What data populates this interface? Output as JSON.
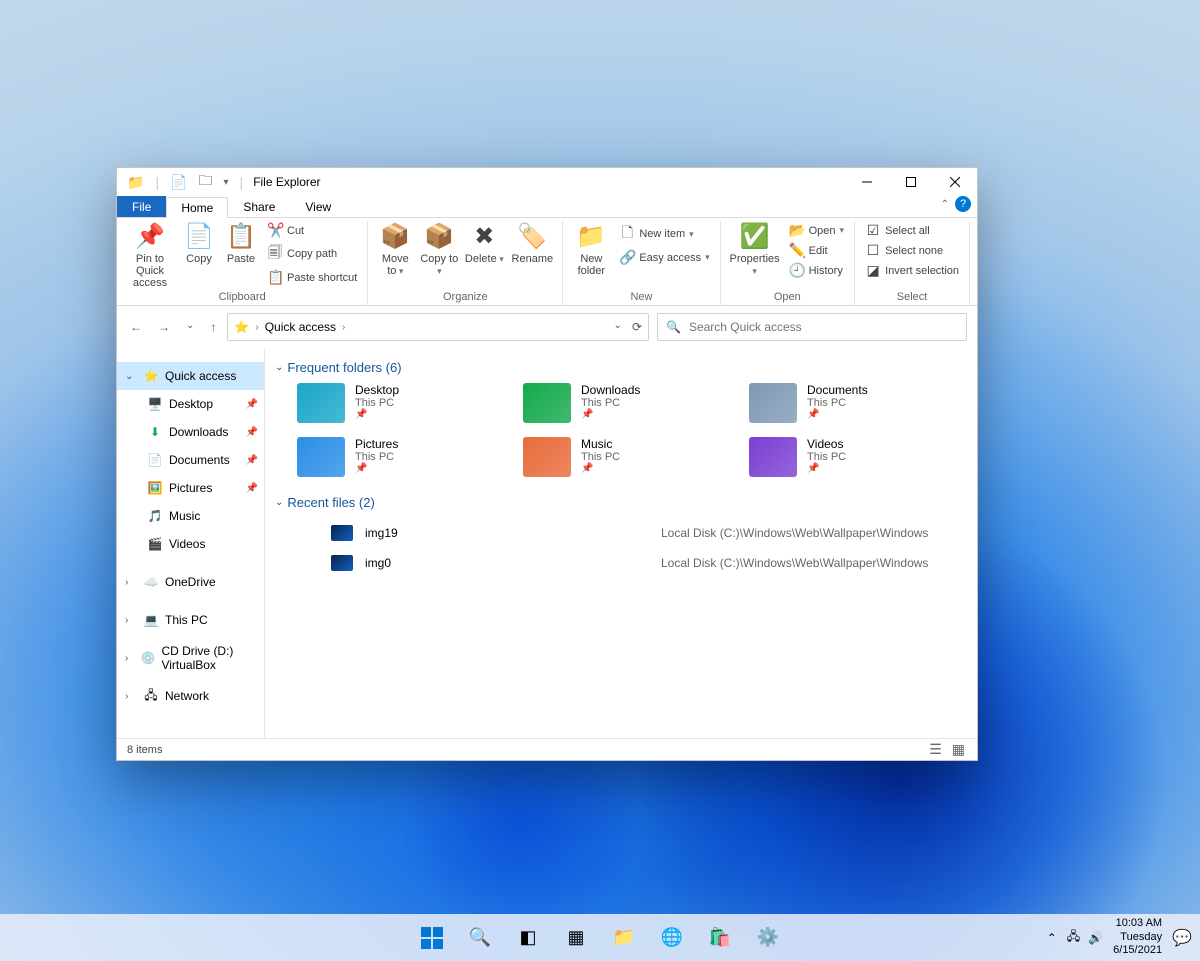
{
  "window": {
    "title": "File Explorer",
    "tabs": {
      "file": "File",
      "home": "Home",
      "share": "Share",
      "view": "View"
    }
  },
  "ribbon": {
    "clipboard": {
      "label": "Clipboard",
      "pin": "Pin to Quick access",
      "copy": "Copy",
      "paste": "Paste",
      "cut": "Cut",
      "copy_path": "Copy path",
      "paste_shortcut": "Paste shortcut"
    },
    "organize": {
      "label": "Organize",
      "move": "Move to",
      "copy": "Copy to",
      "delete": "Delete",
      "rename": "Rename"
    },
    "new_group": {
      "label": "New",
      "new_folder": "New folder",
      "new_item": "New item",
      "easy_access": "Easy access"
    },
    "open_group": {
      "label": "Open",
      "properties": "Properties",
      "open": "Open",
      "edit": "Edit",
      "history": "History"
    },
    "select_group": {
      "label": "Select",
      "select_all": "Select all",
      "select_none": "Select none",
      "invert": "Invert selection"
    }
  },
  "address": {
    "location": "Quick access",
    "search_placeholder": "Search Quick access"
  },
  "sidebar": {
    "quick_access": "Quick access",
    "desktop": "Desktop",
    "downloads": "Downloads",
    "documents": "Documents",
    "pictures": "Pictures",
    "music": "Music",
    "videos": "Videos",
    "onedrive": "OneDrive",
    "this_pc": "This PC",
    "cd_drive": "CD Drive (D:) VirtualBox",
    "network": "Network"
  },
  "content": {
    "frequent_header": "Frequent folders (6)",
    "recent_header": "Recent files (2)",
    "folders": [
      {
        "name": "Desktop",
        "sub": "This PC",
        "color": "#1aa7c9"
      },
      {
        "name": "Downloads",
        "sub": "This PC",
        "color": "#14a94b"
      },
      {
        "name": "Documents",
        "sub": "This PC",
        "color": "#7e99b4"
      },
      {
        "name": "Pictures",
        "sub": "This PC",
        "color": "#2b8ee6"
      },
      {
        "name": "Music",
        "sub": "This PC",
        "color": "#e86b3a"
      },
      {
        "name": "Videos",
        "sub": "This PC",
        "color": "#7a3fd1"
      }
    ],
    "recent": [
      {
        "name": "img19",
        "path": "Local Disk (C:)\\Windows\\Web\\Wallpaper\\Windows"
      },
      {
        "name": "img0",
        "path": "Local Disk (C:)\\Windows\\Web\\Wallpaper\\Windows"
      }
    ]
  },
  "status": {
    "text": "8 items"
  },
  "taskbar": {
    "time": "10:03 AM",
    "day": "Tuesday",
    "date": "6/15/2021"
  }
}
